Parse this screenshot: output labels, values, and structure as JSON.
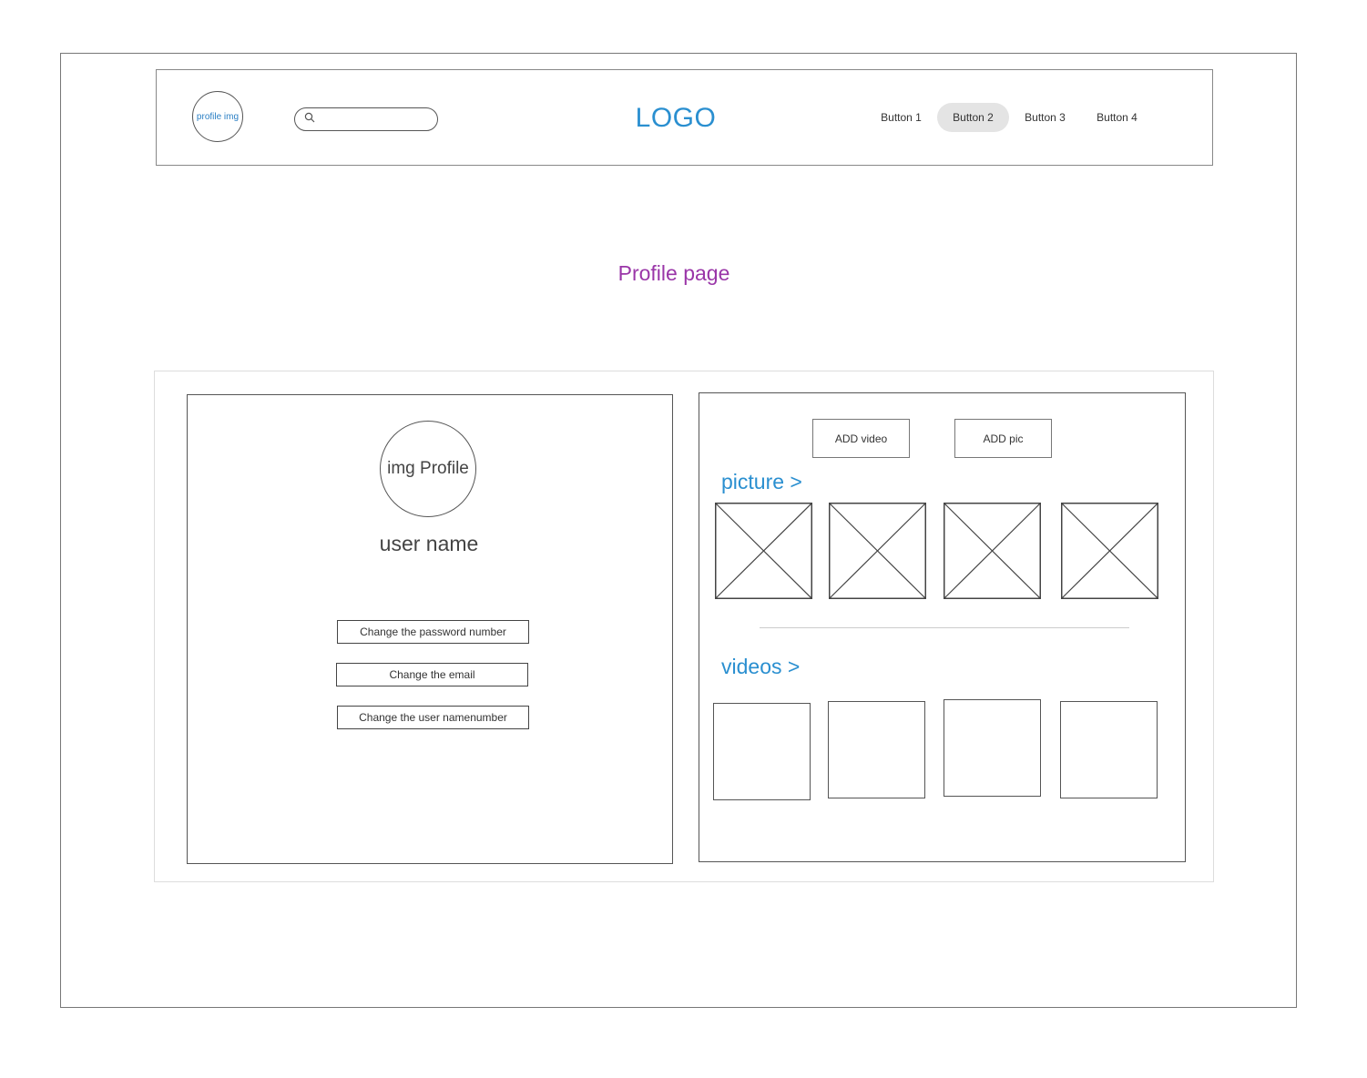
{
  "header": {
    "profile_img_label": "profile img",
    "search_placeholder": "",
    "logo": "LOGO",
    "nav": [
      "Button 1",
      "Button 2",
      "Button 3",
      "Button 4"
    ],
    "active_nav": "Button 2"
  },
  "page_title": "Profile page",
  "profile": {
    "img_label": "img Profile",
    "username": "user name",
    "actions": [
      "Change the password number",
      "Change the email",
      "Change the user namenumber"
    ]
  },
  "media": {
    "add_video": "ADD video",
    "add_pic": "ADD pic",
    "picture_title": "picture >",
    "videos_title": "videos >"
  },
  "colors": {
    "accent_blue": "#2a8fd0",
    "title_purple": "#9a36a8",
    "active_nav_bg": "#e4e4e4"
  }
}
